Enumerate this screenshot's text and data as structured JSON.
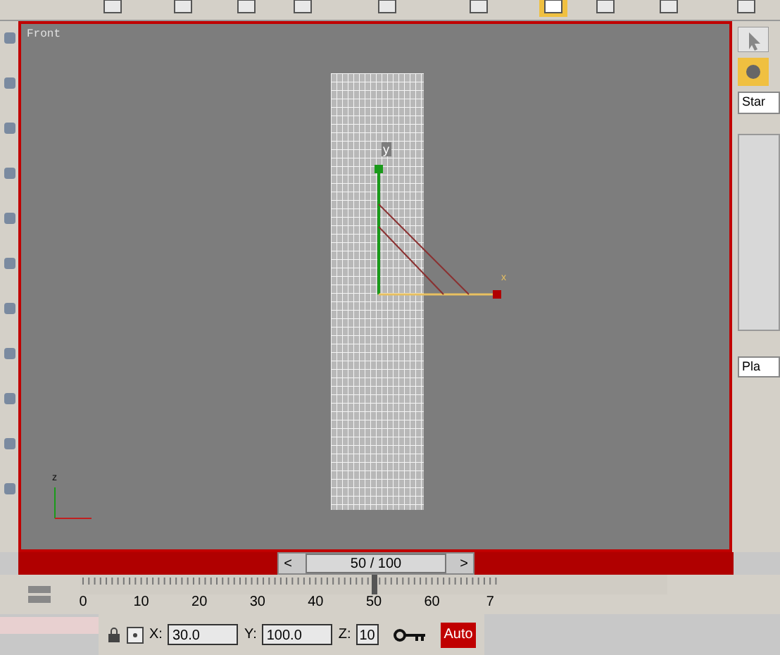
{
  "viewport": {
    "label": "Front",
    "active": true
  },
  "gizmo": {
    "y_label": "y",
    "x_label": "x"
  },
  "axis_tripod": {
    "z_label": "z"
  },
  "frame_slider": {
    "prev": "<",
    "reading": "50 / 100",
    "next": ">",
    "level": 0.5
  },
  "timeline": {
    "ticks": [
      "0",
      "10",
      "20",
      "30",
      "40",
      "50",
      "60",
      "7"
    ],
    "level": 0.5
  },
  "coordinates": {
    "x_label": "X:",
    "x_value": "30.0",
    "y_label": "Y:",
    "y_value": "100.0",
    "z_label": "Z:",
    "z_value": "10"
  },
  "auto_key": {
    "label": "Auto",
    "on": true
  },
  "command_panel": {
    "dropdown": "Star",
    "rollout_field": "Pla"
  }
}
